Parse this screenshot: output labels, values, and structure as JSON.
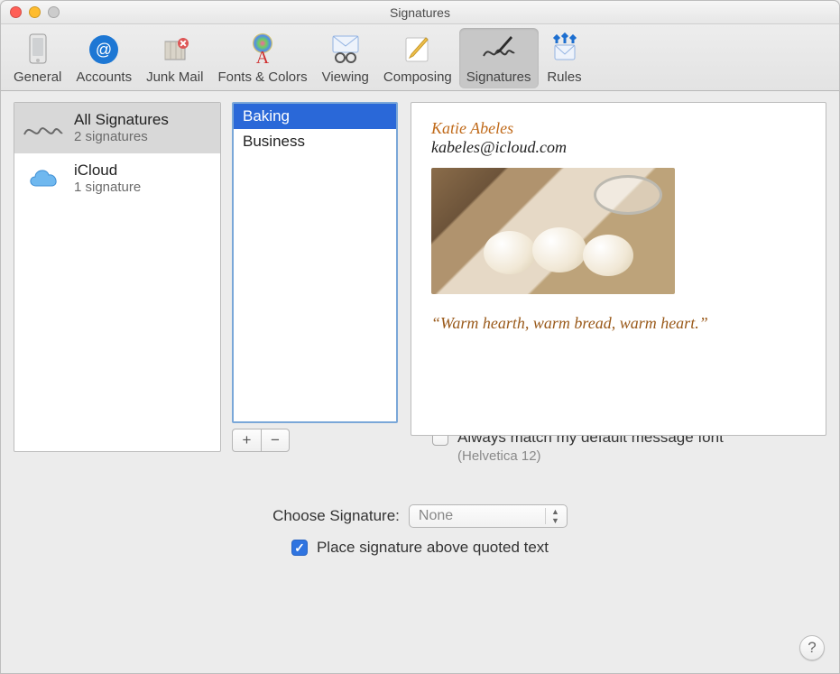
{
  "window": {
    "title": "Signatures"
  },
  "toolbar": {
    "items": [
      {
        "label": "General",
        "icon": "general-icon"
      },
      {
        "label": "Accounts",
        "icon": "accounts-icon"
      },
      {
        "label": "Junk Mail",
        "icon": "junkmail-icon"
      },
      {
        "label": "Fonts & Colors",
        "icon": "fonts-colors-icon"
      },
      {
        "label": "Viewing",
        "icon": "viewing-icon"
      },
      {
        "label": "Composing",
        "icon": "composing-icon"
      },
      {
        "label": "Signatures",
        "icon": "signatures-icon"
      },
      {
        "label": "Rules",
        "icon": "rules-icon"
      }
    ],
    "active_index": 6
  },
  "sources": [
    {
      "title": "All Signatures",
      "subtitle": "2 signatures",
      "selected": true,
      "icon": "all-signatures-icon"
    },
    {
      "title": "iCloud",
      "subtitle": "1 signature",
      "selected": false,
      "icon": "icloud-icon"
    }
  ],
  "signatures": [
    {
      "name": "Baking",
      "selected": true
    },
    {
      "name": "Business",
      "selected": false
    }
  ],
  "list_buttons": {
    "add": "+",
    "remove": "−"
  },
  "preview": {
    "name": "Katie Abeles",
    "email": "kabeles@icloud.com",
    "quote": "“Warm hearth, warm bread, warm heart.”"
  },
  "match_font": {
    "label": "Always match my default message font",
    "checked": false,
    "hint": "(Helvetica 12)"
  },
  "choose": {
    "label": "Choose Signature:",
    "value": "None"
  },
  "place_above": {
    "label": "Place signature above quoted text",
    "checked": true
  },
  "help": {
    "label": "?"
  }
}
